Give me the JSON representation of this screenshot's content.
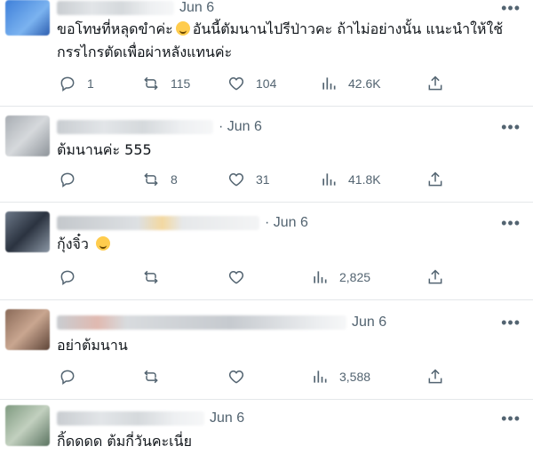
{
  "replies": [
    {
      "date": "Jun 6",
      "text_line1": "ขอโทษที่หลุดขำค่ะ",
      "text_line1b": "อันนี้ตัมนานไปรีป่าวคะ ถ้าไม่อย่างนั้น แนะนำให้ใช้",
      "text_line2": "กรรไกรตัดเพื่อผ่าหลังแทนค่ะ",
      "replies": "1",
      "reposts": "115",
      "likes": "104",
      "views": "42.6K"
    },
    {
      "date": "· Jun 6",
      "text": "ต้มนานค่ะ 555",
      "replies": "",
      "reposts": "8",
      "likes": "31",
      "views": "41.8K"
    },
    {
      "date": "· Jun 6",
      "text": "กุ้งจิ๋ว",
      "replies": "",
      "reposts": "",
      "likes": "",
      "views": "2,825"
    },
    {
      "date": "Jun 6",
      "text": "อย่าต้มนาน",
      "replies": "",
      "reposts": "",
      "likes": "",
      "views": "3,588"
    },
    {
      "date": "Jun 6",
      "text": "กิ้ดดดด ต้มกี่วันคะเนี่ย",
      "replies": "",
      "reposts": "",
      "likes": "",
      "views": ""
    }
  ],
  "icons": {
    "reply": "reply-icon",
    "repost": "repost-icon",
    "like": "heart-icon",
    "views": "views-icon",
    "share": "share-icon",
    "more": "more-icon"
  },
  "colors": {
    "text": "#0f1419",
    "muted": "#536471",
    "divider": "#e4e7ea",
    "emoji": "#ffcc4d"
  }
}
